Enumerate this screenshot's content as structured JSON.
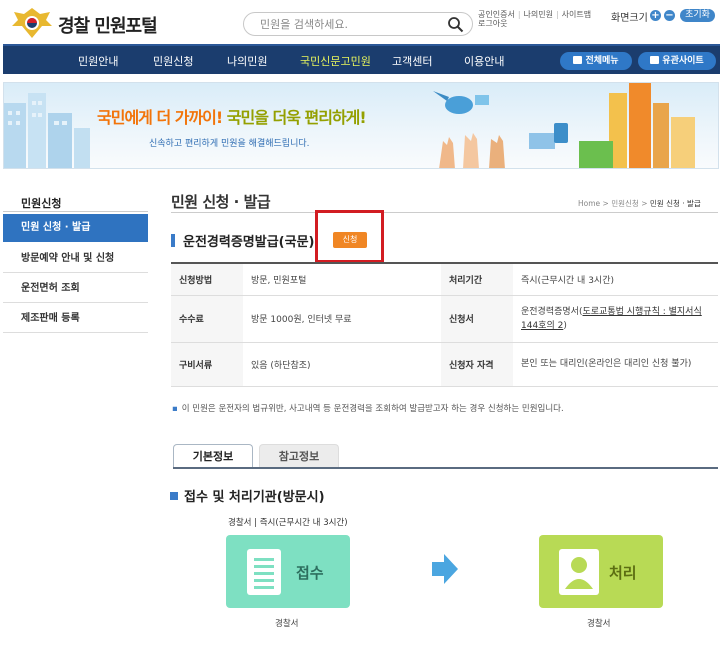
{
  "header": {
    "site_title": "경찰 민원포털",
    "search_placeholder": "민원을 검색하세요.",
    "util_row1": [
      "공인인증서",
      "나의민원",
      "사이트맵"
    ],
    "util_row2": "로그아웃",
    "font_size_label": "화면크기",
    "reset_label": "초기화",
    "plus": "+",
    "minus": "−"
  },
  "gnb": {
    "items": [
      "민원안내",
      "민원신청",
      "나의민원",
      "국민신문고민원",
      "고객센터",
      "이용안내"
    ],
    "active_index": 3,
    "full_menu": "전체메뉴",
    "related_sites": "유관사이트"
  },
  "banner": {
    "title_part1": "국민에게 더 가까이! ",
    "title_part2": "국민을 더욱 편리하게!",
    "subtitle": "신속하고 편리하게 민원을 해결해드립니다."
  },
  "lnb": {
    "title": "민원신청",
    "items": [
      "민원 신청 · 발급",
      "방문예약 안내 및 신청",
      "운전면허 조회",
      "제조판매 등록"
    ],
    "active_index": 0
  },
  "content": {
    "page_title": "민원 신청 · 발급",
    "breadcrumb": [
      "Home",
      "민원신청",
      "민원 신청 · 발급"
    ],
    "section_title": "운전경력증명발급(국문)",
    "apply_button": "신청",
    "table": {
      "rows": [
        {
          "h1": "신청방법",
          "v1": "방문, 민원포털",
          "h2": "처리기간",
          "v2": "즉시(근무시간 내 3시간)"
        },
        {
          "h1": "수수료",
          "v1": "방문 1000원, 인터넷 무료",
          "h2": "신청서",
          "v2_prefix": "운전경력증명서(",
          "v2_link": "도로교통법 시행규칙 : 별지서식 144호의 2",
          "v2_suffix": ")"
        },
        {
          "h1": "구비서류",
          "v1": "있음 (하단참조)",
          "h2": "신청자 자격",
          "v2": "본인 또는 대리인(온라인은 대리인 신청 불가)"
        }
      ]
    },
    "note": "이 민원은 운전자의 법규위반, 사고내역 등 운전경력을 조회하여 발급받고자 하는 경우 신청하는 민원입니다.",
    "tabs": [
      "기본정보",
      "참고정보"
    ],
    "active_tab": 0,
    "sub_title": "접수 및 처리기관(방문시)",
    "process_label": "경찰서 | 즉시(근무시간 내 3시간)",
    "step1": "접수",
    "step2": "처리",
    "step1_org": "경찰서",
    "step2_org": "경찰서"
  },
  "colors": {
    "gnb_bg": "#1b3d6e",
    "accent_blue": "#2f73c0",
    "apply_orange": "#f08624",
    "highlight_red": "#d21c22",
    "receive_green": "#7ee0c2",
    "process_green": "#b8da55"
  }
}
